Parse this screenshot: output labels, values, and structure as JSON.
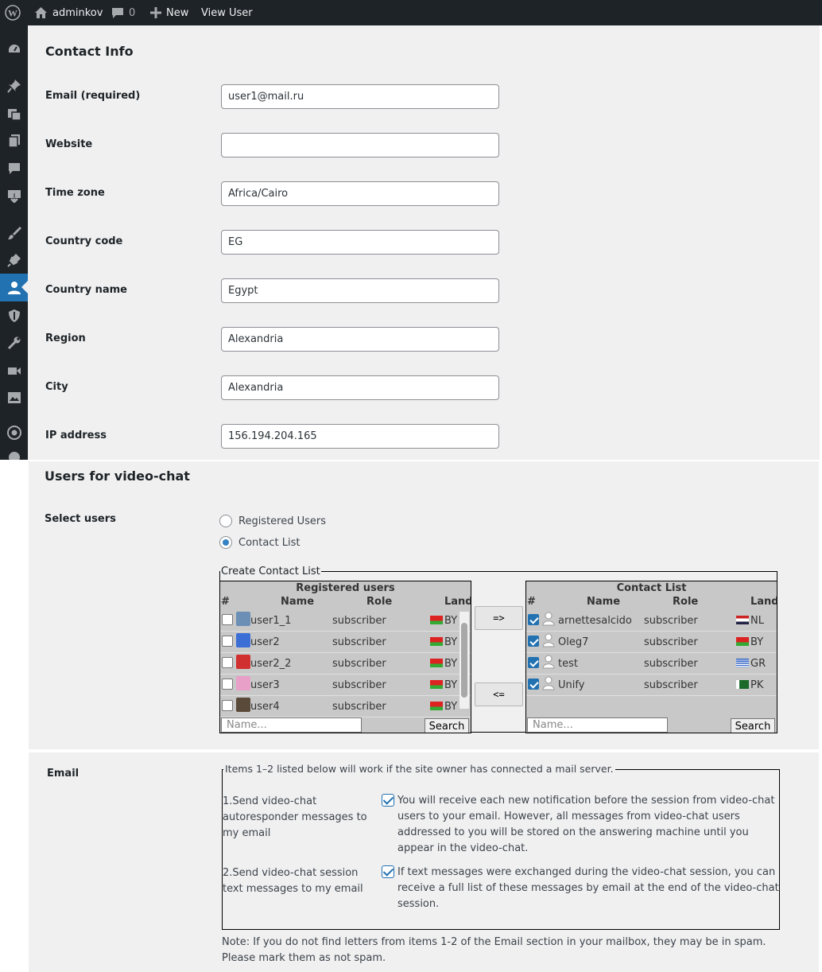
{
  "adminbar": {
    "wp_logo": "wordpress-icon",
    "site_name": "adminkov",
    "comments_count": "0",
    "new_label": "New",
    "view_user_label": "View User"
  },
  "sidebar": {
    "items": [
      "dashboard-icon",
      "pin-icon",
      "media-icon",
      "pages-icon",
      "comments-icon",
      "download-icon",
      "appearance-icon",
      "plugins-icon",
      "users-icon",
      "shield-icon",
      "tools-icon",
      "video-icon",
      "gallery-icon",
      "eye-icon"
    ],
    "active_index": 8
  },
  "contact_info": {
    "title": "Contact Info",
    "fields": [
      {
        "label": "Email (required)",
        "value": "user1@mail.ru"
      },
      {
        "label": "Website",
        "value": ""
      },
      {
        "label": "Time zone",
        "value": "Africa/Cairo"
      },
      {
        "label": "Country code",
        "value": "EG"
      },
      {
        "label": "Country name",
        "value": "Egypt"
      },
      {
        "label": "Region",
        "value": "Alexandria"
      },
      {
        "label": "City",
        "value": "Alexandria"
      },
      {
        "label": "IP address",
        "value": "156.194.204.165"
      }
    ]
  },
  "video_chat": {
    "title": "Users for video-chat",
    "select_label": "Select users",
    "radios": [
      {
        "label": "Registered Users",
        "checked": false
      },
      {
        "label": "Contact List",
        "checked": true
      }
    ],
    "fieldset_legend": "Create Contact List",
    "registered": {
      "title": "Registered users",
      "columns": [
        "#",
        "Name",
        "Role",
        "Land"
      ],
      "rows": [
        {
          "name": "user1_1",
          "role": "subscriber",
          "land": "BY"
        },
        {
          "name": "user2",
          "role": "subscriber",
          "land": "BY"
        },
        {
          "name": "user2_2",
          "role": "subscriber",
          "land": "BY"
        },
        {
          "name": "user3",
          "role": "subscriber",
          "land": "BY"
        },
        {
          "name": "user4",
          "role": "subscriber",
          "land": "BY"
        }
      ],
      "search_placeholder": "Name...",
      "search_button": "Search"
    },
    "move_right": "=>",
    "move_left": "<=",
    "contacts": {
      "title": "Contact List",
      "columns": [
        "#",
        "Name",
        "Role",
        "Land"
      ],
      "rows": [
        {
          "name": "arnettesalcido",
          "role": "subscriber",
          "land": "NL"
        },
        {
          "name": "Oleg7",
          "role": "subscriber",
          "land": "BY"
        },
        {
          "name": "test",
          "role": "subscriber",
          "land": "GR"
        },
        {
          "name": "Unify",
          "role": "subscriber",
          "land": "PK"
        }
      ],
      "search_placeholder": "Name...",
      "search_button": "Search"
    }
  },
  "email": {
    "label": "Email",
    "legend": "Items 1–2 listed below will work if the site owner has connected a mail server.",
    "items": [
      {
        "label": "1.Send video-chat autoresponder messages to my email",
        "desc": "You will receive each new notification before the session from video-chat users to your email. However, all messages from video-chat users addressed to you will be stored on the answering machine until you appear in the video-chat."
      },
      {
        "label": "2.Send video-chat session text messages to my email",
        "desc": "If text messages were exchanged during the video-chat session, you can receive a full list of these messages by email at the end of the video-chat session."
      }
    ],
    "note": "Note: If you do not find letters from items 1-2 of the Email section in your mailbox, they may be in spam. Please mark them as not spam."
  },
  "colors": {
    "admin_dark": "#1d2327",
    "accent": "#2271b1",
    "panel_bg": "#f0f0f1"
  }
}
